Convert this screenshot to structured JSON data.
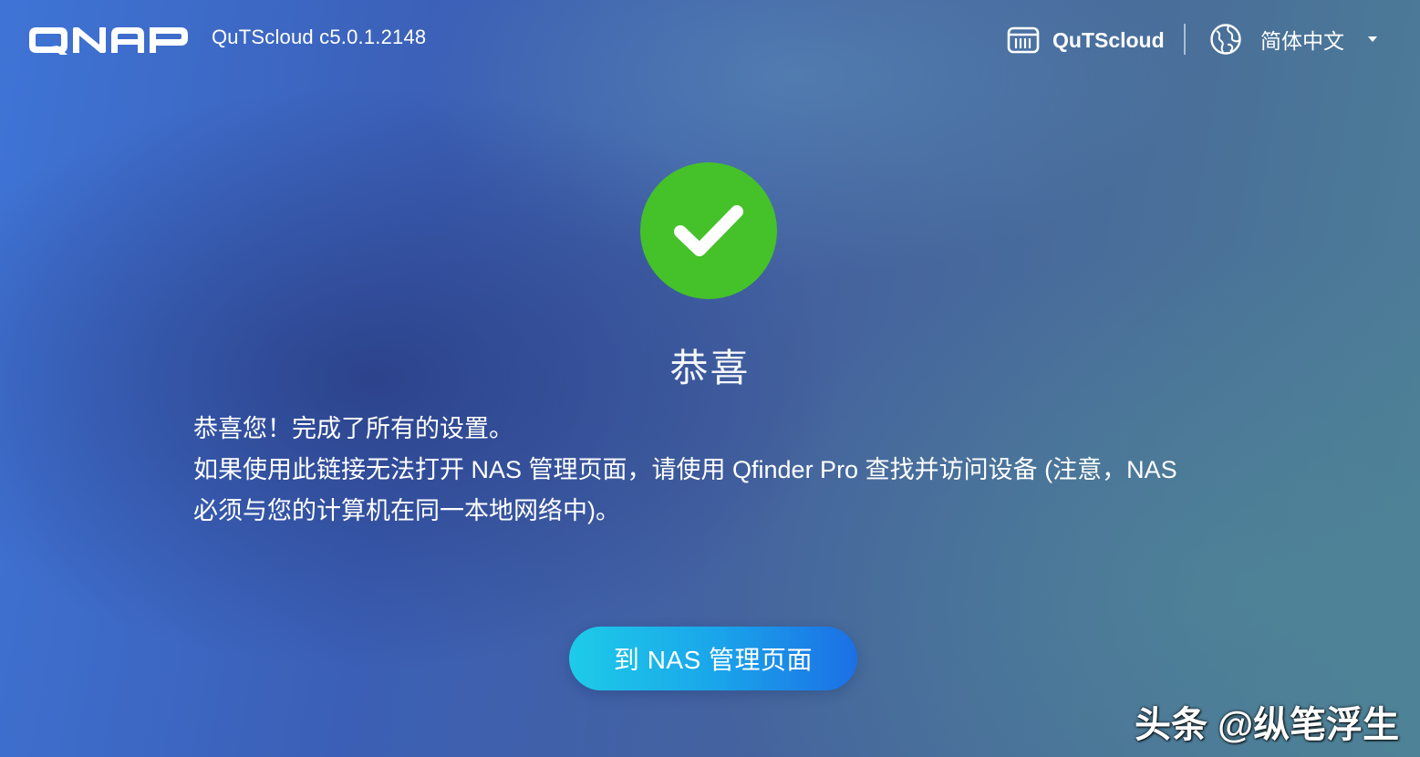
{
  "header": {
    "logo_text": "QNAP",
    "version": "QuTScloud c5.0.1.2148",
    "brand_label": "QuTScloud",
    "language": "简体中文"
  },
  "main": {
    "title": "恭喜",
    "message_line1": "恭喜您！完成了所有的设置。",
    "message_line2": "如果使用此链接无法打开 NAS 管理页面，请使用 Qfinder Pro 查找并访问设备 (注意，NAS 必须与您的计算机在同一本地网络中)。",
    "button_label": "到 NAS 管理页面"
  },
  "watermark": "头条 @纵笔浮生",
  "colors": {
    "success": "#45c12a",
    "button_start": "#1ecbe8",
    "button_end": "#1c6fe6"
  },
  "icons": {
    "brand": "nas-device-icon",
    "language": "globe-icon",
    "status": "checkmark-icon"
  }
}
